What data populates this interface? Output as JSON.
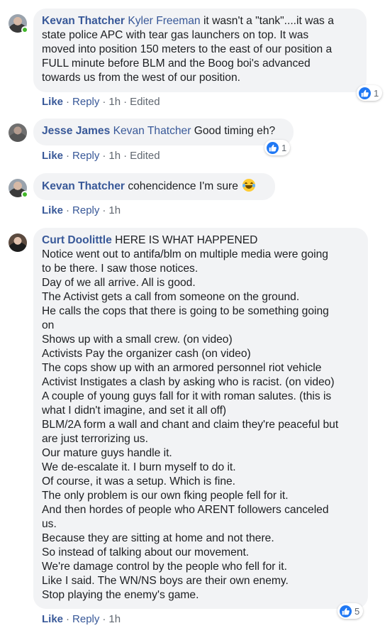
{
  "comments": [
    {
      "author": "Kevan Thatcher",
      "tagged": "Kyler Freeman",
      "lines": [
        " it wasn't a \"tank\"....it was a",
        "state police APC with tear gas launchers on top. It was",
        "moved into position 150 meters to the east of our position a",
        "FULL minute before BLM and the Boog boi's advanced",
        "towards us from the west of our position."
      ],
      "like_label": "Like",
      "reply_label": "Reply",
      "time": "1h",
      "edited": "Edited",
      "reaction_count": "1",
      "online": true
    },
    {
      "author": "Jesse James",
      "tagged": "Kevan Thatcher",
      "lines": [
        " Good timing eh?"
      ],
      "like_label": "Like",
      "reply_label": "Reply",
      "time": "1h",
      "edited": "Edited",
      "reaction_count": "1",
      "online": false
    },
    {
      "author": "Kevan Thatcher",
      "lines": [
        " cohencidence I'm sure"
      ],
      "emoji": "laughing-tears-emoji",
      "like_label": "Like",
      "reply_label": "Reply",
      "time": "1h",
      "online": true
    },
    {
      "author": "Curt Doolittle",
      "lines": [
        " HERE IS WHAT HAPPENED",
        "Notice went out to antifa/blm on multiple media were going",
        "to be there. I saw those notices.",
        "Day of we all arrive. All is good.",
        "The Activist gets a call from someone on the ground.",
        "He calls the cops that there is going to be something going",
        "on",
        "Shows up with a small crew. (on video)",
        "Activists Pay the organizer cash (on video)",
        "The cops show up with an armored personnel riot vehicle",
        "Activist Instigates a clash by asking who is racist. (on video)",
        "A couple of young guys fall for it with roman salutes. (this is",
        "what I didn't imagine, and set it all off)",
        "BLM/2A form a wall and chant and claim they're peaceful but",
        "are just terrorizing us.",
        "Our mature guys handle it.",
        "We de-escalate it. I burn myself to do it.",
        "Of course, it was a setup. Which is fine.",
        "The only problem is our own fking people fell for it.",
        "And then hordes of people who ARENT followers canceled",
        "us.",
        "Because they are sitting at home and not there.",
        "So instead of talking about our movement.",
        "We're damage control by the people who fell for it.",
        "Like I said. The WN/NS boys are their own enemy.",
        "Stop playing the enemy's game."
      ],
      "like_label": "Like",
      "reply_label": "Reply",
      "time": "1h",
      "reaction_count": "5",
      "online": false
    }
  ],
  "colors": {
    "name_blue": "#385898",
    "bubble_bg": "#f2f3f5",
    "meta_gray": "#606770",
    "like_blue": "#2078f4",
    "online_green": "#42b72a"
  },
  "icons": {
    "reaction": "thumbs-up-icon",
    "emoji": "laughing-tears-emoji"
  }
}
